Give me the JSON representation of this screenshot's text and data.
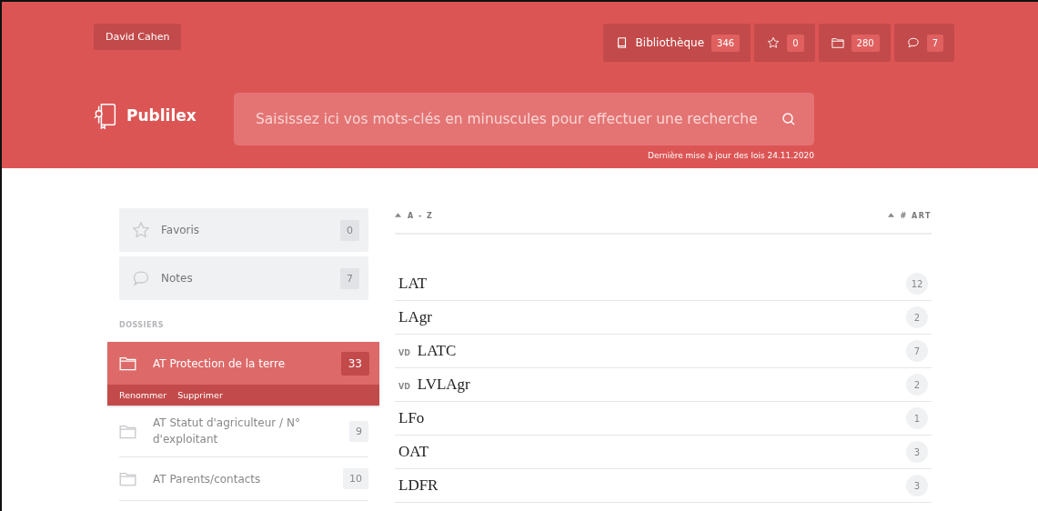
{
  "user": {
    "name": "David Cahen"
  },
  "nav": [
    {
      "kind": "library",
      "label": "Bibliothèque",
      "count": "346"
    },
    {
      "kind": "star",
      "count": "0"
    },
    {
      "kind": "folder",
      "count": "280"
    },
    {
      "kind": "comment",
      "count": "7"
    }
  ],
  "brand": {
    "name": "Publilex"
  },
  "search": {
    "placeholder": "Saisissez ici vos mots-clés en minuscules pour effectuer une recherche"
  },
  "update_note": "Dernière mise à jour des lois 24.11.2020",
  "shortcuts": [
    {
      "kind": "star",
      "label": "Favoris",
      "count": "0"
    },
    {
      "kind": "comment",
      "label": "Notes",
      "count": "7"
    }
  ],
  "folders_heading": "DOSSIERS",
  "folders": [
    {
      "label": "AT Protection de la terre",
      "count": "33",
      "selected": true,
      "actions": [
        "Renommer",
        "Supprimer"
      ]
    },
    {
      "label": "AT Statut d'agriculteur / N° d'exploitant",
      "count": "9",
      "selected": false
    },
    {
      "label": "AT Parents/contacts",
      "count": "10",
      "selected": false
    }
  ],
  "table": {
    "columns": [
      "A - Z",
      "# ART"
    ],
    "rows": [
      {
        "name": "LAT",
        "count": "12"
      },
      {
        "name": "LAgr",
        "count": "2"
      },
      {
        "prefix": "VD",
        "name": "LATC",
        "count": "7"
      },
      {
        "prefix": "VD",
        "name": "LVLAgr",
        "count": "2"
      },
      {
        "name": "LFo",
        "count": "1"
      },
      {
        "name": "OAT",
        "count": "3"
      },
      {
        "name": "LDFR",
        "count": "3"
      }
    ]
  }
}
